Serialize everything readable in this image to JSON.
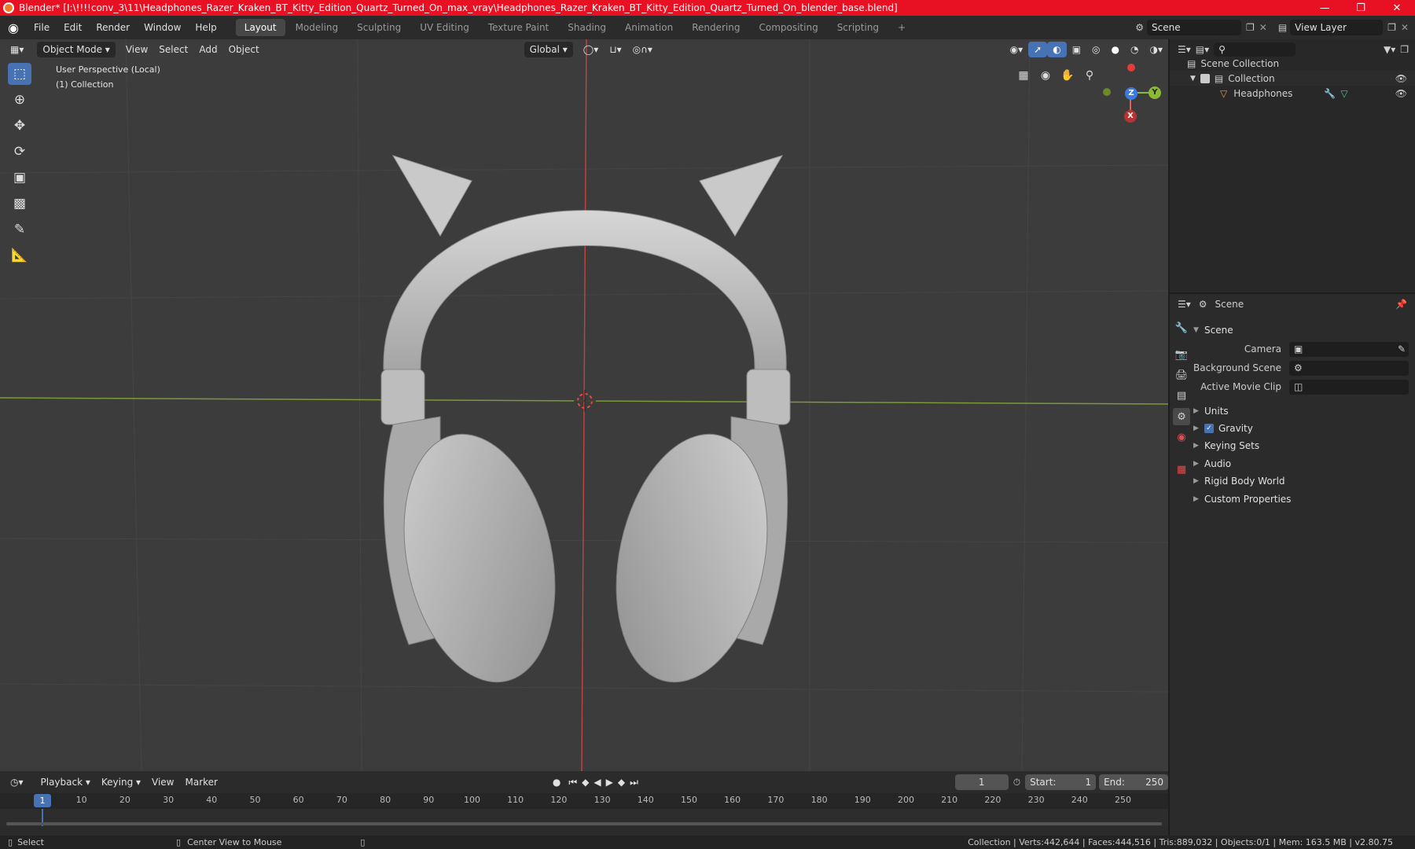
{
  "window": {
    "title": "Blender* [I:\\!!!!conv_3\\11\\Headphones_Razer_Kraken_BT_Kitty_Edition_Quartz_Turned_On_max_vray\\Headphones_Razer_Kraken_BT_Kitty_Edition_Quartz_Turned_On_blender_base.blend]"
  },
  "menu": [
    "File",
    "Edit",
    "Render",
    "Window",
    "Help"
  ],
  "workspaces": [
    "Layout",
    "Modeling",
    "Sculpting",
    "UV Editing",
    "Texture Paint",
    "Shading",
    "Animation",
    "Rendering",
    "Compositing",
    "Scripting"
  ],
  "scene_field": "Scene",
  "view_layer_field": "View Layer",
  "viewport": {
    "mode": "Object Mode",
    "menus": [
      "View",
      "Select",
      "Add",
      "Object"
    ],
    "transform": "Global",
    "info_line1": "User Perspective (Local)",
    "info_line2": "(1) Collection",
    "gizmo": {
      "z": "Z",
      "y": "Y",
      "x": "X"
    }
  },
  "outliner": {
    "root": "Scene Collection",
    "collection": "Collection",
    "object": "Headphones"
  },
  "properties": {
    "header": "Scene",
    "section": "Scene",
    "rows": [
      {
        "label": "Camera"
      },
      {
        "label": "Background Scene"
      },
      {
        "label": "Active Movie Clip"
      }
    ],
    "subsections": [
      "Units",
      "Gravity",
      "Keying Sets",
      "Audio",
      "Rigid Body World",
      "Custom Properties"
    ]
  },
  "timeline": {
    "menus": [
      "Playback",
      "Keying",
      "View",
      "Marker"
    ],
    "current_frame": "1",
    "start_label": "Start:",
    "start": "1",
    "end_label": "End:",
    "end": "250",
    "ticks": [
      "1",
      "10",
      "20",
      "30",
      "40",
      "50",
      "60",
      "70",
      "80",
      "90",
      "100",
      "110",
      "120",
      "130",
      "140",
      "150",
      "160",
      "170",
      "180",
      "190",
      "200",
      "210",
      "220",
      "230",
      "240",
      "250"
    ]
  },
  "status": {
    "left1": "Select",
    "left2": "Center View to Mouse",
    "right": "Collection | Verts:442,644 | Faces:444,516 | Tris:889,032 | Objects:0/1 | Mem: 163.5 MB | v2.80.75"
  },
  "colors": {
    "titlebar": "#e81123",
    "accent": "#4772b3",
    "x_axis": "#e06060",
    "y_axis": "#8cba34",
    "z_axis": "#3a7be0"
  }
}
